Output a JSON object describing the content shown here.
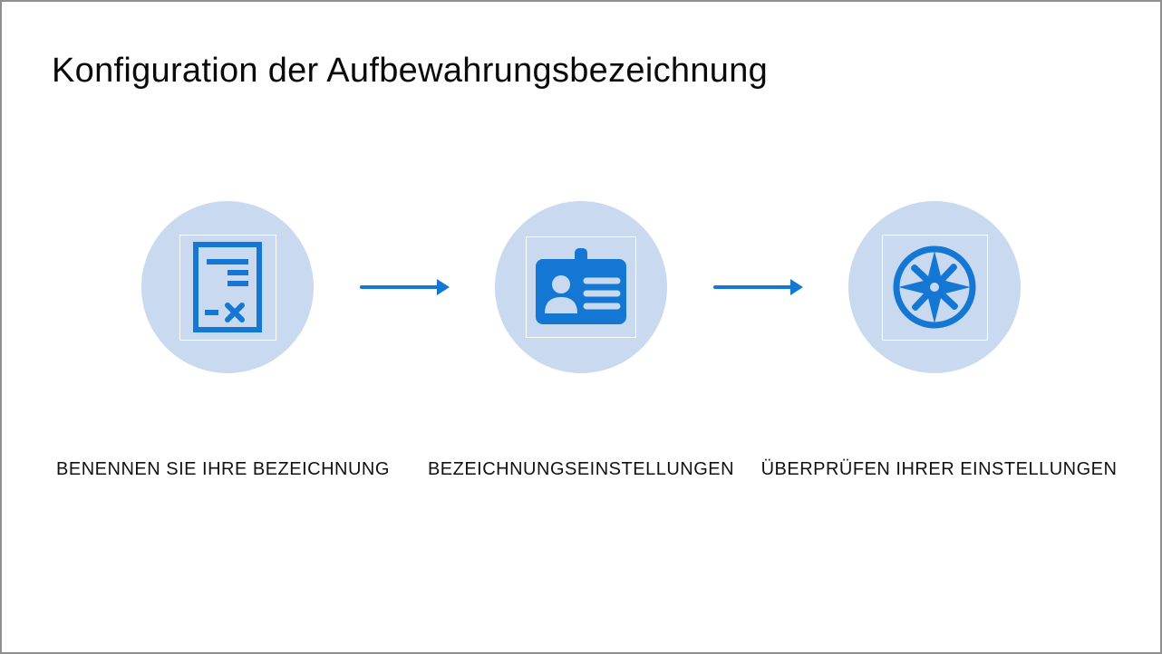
{
  "title": "Konfiguration der Aufbewahrungsbezeichnung",
  "colors": {
    "accent": "#1477d3",
    "circle_bg": "#c9d9ef"
  },
  "steps": [
    {
      "icon": "document-contract-icon",
      "label": "BENENNEN SIE IHRE BEZEICHNUNG"
    },
    {
      "icon": "id-badge-icon",
      "label": "BEZEICHNUNGSEINSTELLUNGEN"
    },
    {
      "icon": "compass-icon",
      "label": "ÜBERPRÜFEN IHRER EINSTELLUNGEN"
    }
  ]
}
